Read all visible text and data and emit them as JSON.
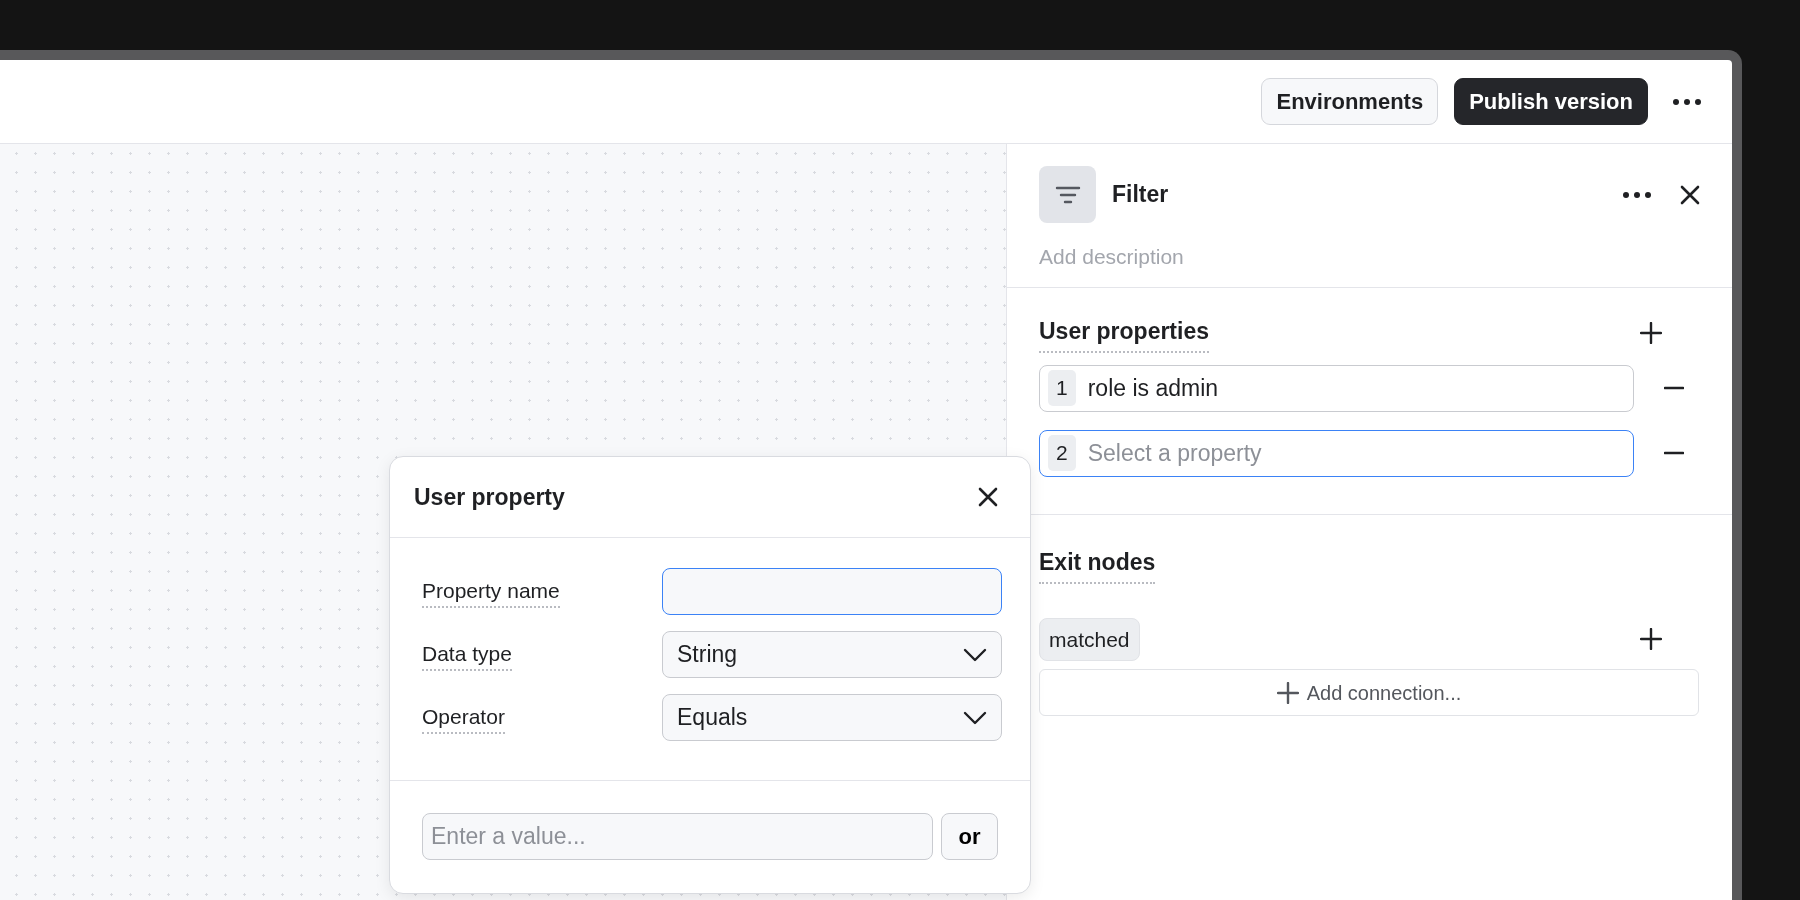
{
  "header": {
    "buttons": [
      {
        "label": "Environments",
        "kind": "secondary"
      },
      {
        "label": "Publish version",
        "kind": "primary"
      }
    ]
  },
  "panel": {
    "title": "Filter",
    "description_placeholder": "Add description",
    "user_properties": {
      "heading": "User properties",
      "items": [
        {
          "number": "1",
          "value": "role is admin",
          "focused": false
        },
        {
          "number": "2",
          "placeholder": "Select a property",
          "focused": true
        }
      ]
    },
    "exit_nodes": {
      "heading": "Exit nodes",
      "items": [
        {
          "label": "matched"
        }
      ],
      "add_label": "Add connection..."
    }
  },
  "popup": {
    "title": "User property",
    "fields": [
      {
        "label": "Property name",
        "kind": "text",
        "focused": true
      },
      {
        "label": "Data type",
        "kind": "select",
        "value": "String"
      },
      {
        "label": "Operator",
        "kind": "select",
        "value": "Equals"
      }
    ],
    "value_placeholder": "Enter a value...",
    "or_label": "or"
  }
}
